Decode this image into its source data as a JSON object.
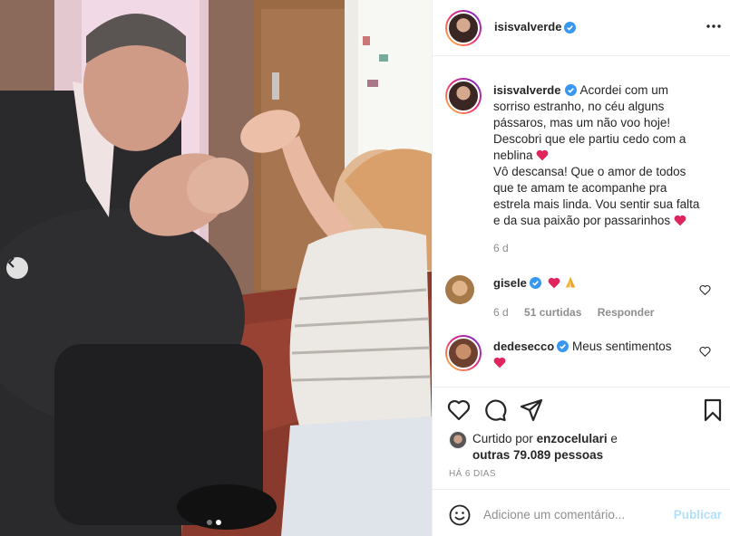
{
  "post": {
    "author": "isisvalverde",
    "verified": true,
    "caption_lines": [
      "Acordei com um",
      "sorriso estranho, no céu alguns",
      "pássaros, mas um não voo hoje!",
      "Descobri que ele partiu cedo com a",
      "neblina",
      "Vô descansa! Que o amor de todos",
      "que te amam te acompanhe pra",
      "estrela mais linda. Vou sentir sua falta",
      "e da sua paixão por passarinhos"
    ],
    "caption_time": "6 d",
    "carousel": {
      "slides": 2,
      "active_index": 1
    }
  },
  "comments": [
    {
      "user": "gisele",
      "verified": true,
      "text": "",
      "emojis": [
        "red-heart",
        "praying-hands"
      ],
      "time": "6 d",
      "likes": "51 curtidas",
      "reply": "Responder"
    },
    {
      "user": "dedesecco",
      "verified": true,
      "text": "Meus sentimentos",
      "emojis": [
        "red-heart"
      ]
    }
  ],
  "likes": {
    "prefix": "Curtido por",
    "user": "enzocelulari",
    "conj": "e",
    "others": "outras 79.089 pessoas"
  },
  "timestamp": "HÁ 6 DIAS",
  "add_comment": {
    "placeholder": "Adicione um comentário...",
    "publish": "Publicar"
  },
  "icons": [
    "more-icon",
    "heart-icon",
    "comment-icon",
    "share-icon",
    "bookmark-icon",
    "emoji-icon",
    "chevron-left-icon"
  ],
  "colors": {
    "verified": "#3897f0",
    "heart": "#ed4956",
    "publish_disabled": "#b2dffc",
    "muted": "#8e8e8e"
  }
}
